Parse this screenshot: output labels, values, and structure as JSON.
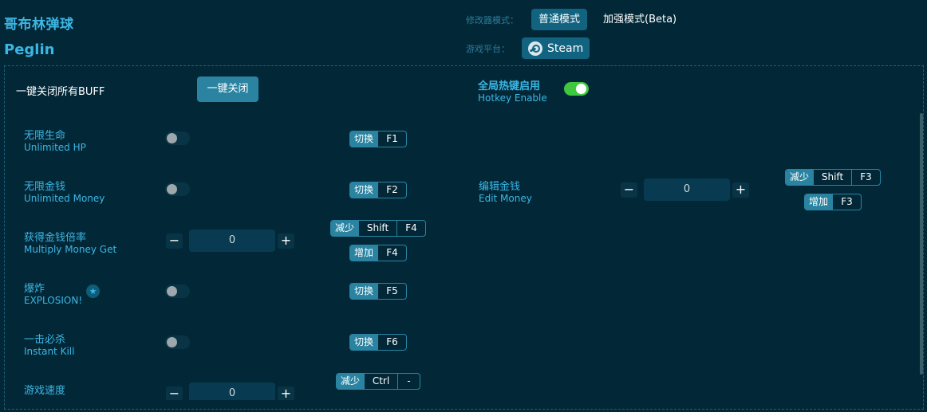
{
  "header": {
    "title_cn": "哥布林弹球",
    "title_en": "Peglin",
    "mode_label": "修改器模式：",
    "modes": [
      {
        "label": "普通模式",
        "active": true
      },
      {
        "label": "加强模式(Beta)",
        "active": false
      }
    ],
    "platform_label": "游戏平台：",
    "platform": {
      "label": "Steam",
      "icon": "steam-icon"
    }
  },
  "top_controls": {
    "close_all_label": "一键关闭所有BUFF",
    "close_all_button": "一键关闭",
    "hotkey_enable_cn": "全局热键启用",
    "hotkey_enable_en": "Hotkey Enable",
    "hotkey_enable_on": true
  },
  "cheats": [
    {
      "cn": "无限生命",
      "en": "Unlimited HP",
      "type": "toggle",
      "on": false,
      "hotkeys": [
        {
          "action": "切换",
          "keys": [
            "F1"
          ]
        }
      ]
    },
    {
      "cn": "无限金钱",
      "en": "Unlimited Money",
      "type": "toggle",
      "on": false,
      "hotkeys": [
        {
          "action": "切换",
          "keys": [
            "F2"
          ]
        }
      ]
    },
    {
      "cn": "获得金钱倍率",
      "en": "Multiply Money Get",
      "type": "stepper",
      "value": "0",
      "hotkeys": [
        {
          "action": "减少",
          "keys": [
            "Shift",
            "F4"
          ]
        },
        {
          "action": "增加",
          "keys": [
            "F4"
          ]
        }
      ]
    },
    {
      "cn": "爆炸",
      "en": "EXPLOSION!",
      "type": "toggle",
      "on": false,
      "starred": true,
      "hotkeys": [
        {
          "action": "切换",
          "keys": [
            "F5"
          ]
        }
      ]
    },
    {
      "cn": "一击必杀",
      "en": "Instant Kill",
      "type": "toggle",
      "on": false,
      "hotkeys": [
        {
          "action": "切换",
          "keys": [
            "F6"
          ]
        }
      ]
    },
    {
      "cn": "游戏速度",
      "en": "",
      "type": "stepper",
      "value": "0",
      "hotkeys": [
        {
          "action": "减少",
          "keys": [
            "Ctrl",
            "-"
          ]
        }
      ]
    }
  ],
  "right_cheats": [
    {
      "cn": "编辑金钱",
      "en": "Edit Money",
      "type": "stepper",
      "value": "0",
      "hotkeys": [
        {
          "action": "减少",
          "keys": [
            "Shift",
            "F3"
          ]
        },
        {
          "action": "增加",
          "keys": [
            "F3"
          ]
        }
      ]
    }
  ],
  "stepper": {
    "minus": "−",
    "plus": "+"
  },
  "star_glyph": "★"
}
